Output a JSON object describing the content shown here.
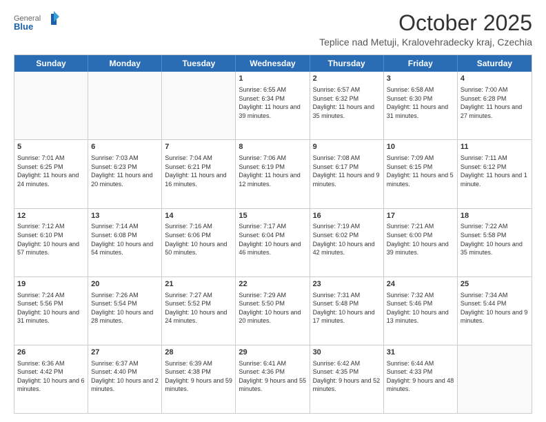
{
  "logo": {
    "general": "General",
    "blue": "Blue"
  },
  "title": "October 2025",
  "subtitle": "Teplice nad Metuji, Kralovehradecky kraj, Czechia",
  "header_days": [
    "Sunday",
    "Monday",
    "Tuesday",
    "Wednesday",
    "Thursday",
    "Friday",
    "Saturday"
  ],
  "weeks": [
    [
      {
        "day": "",
        "empty": true
      },
      {
        "day": "",
        "empty": true
      },
      {
        "day": "",
        "empty": true
      },
      {
        "day": "1",
        "sunrise": "6:55 AM",
        "sunset": "6:34 PM",
        "daylight": "11 hours and 39 minutes."
      },
      {
        "day": "2",
        "sunrise": "6:57 AM",
        "sunset": "6:32 PM",
        "daylight": "11 hours and 35 minutes."
      },
      {
        "day": "3",
        "sunrise": "6:58 AM",
        "sunset": "6:30 PM",
        "daylight": "11 hours and 31 minutes."
      },
      {
        "day": "4",
        "sunrise": "7:00 AM",
        "sunset": "6:28 PM",
        "daylight": "11 hours and 27 minutes."
      }
    ],
    [
      {
        "day": "5",
        "sunrise": "7:01 AM",
        "sunset": "6:25 PM",
        "daylight": "11 hours and 24 minutes."
      },
      {
        "day": "6",
        "sunrise": "7:03 AM",
        "sunset": "6:23 PM",
        "daylight": "11 hours and 20 minutes."
      },
      {
        "day": "7",
        "sunrise": "7:04 AM",
        "sunset": "6:21 PM",
        "daylight": "11 hours and 16 minutes."
      },
      {
        "day": "8",
        "sunrise": "7:06 AM",
        "sunset": "6:19 PM",
        "daylight": "11 hours and 12 minutes."
      },
      {
        "day": "9",
        "sunrise": "7:08 AM",
        "sunset": "6:17 PM",
        "daylight": "11 hours and 9 minutes."
      },
      {
        "day": "10",
        "sunrise": "7:09 AM",
        "sunset": "6:15 PM",
        "daylight": "11 hours and 5 minutes."
      },
      {
        "day": "11",
        "sunrise": "7:11 AM",
        "sunset": "6:12 PM",
        "daylight": "11 hours and 1 minute."
      }
    ],
    [
      {
        "day": "12",
        "sunrise": "7:12 AM",
        "sunset": "6:10 PM",
        "daylight": "10 hours and 57 minutes."
      },
      {
        "day": "13",
        "sunrise": "7:14 AM",
        "sunset": "6:08 PM",
        "daylight": "10 hours and 54 minutes."
      },
      {
        "day": "14",
        "sunrise": "7:16 AM",
        "sunset": "6:06 PM",
        "daylight": "10 hours and 50 minutes."
      },
      {
        "day": "15",
        "sunrise": "7:17 AM",
        "sunset": "6:04 PM",
        "daylight": "10 hours and 46 minutes."
      },
      {
        "day": "16",
        "sunrise": "7:19 AM",
        "sunset": "6:02 PM",
        "daylight": "10 hours and 42 minutes."
      },
      {
        "day": "17",
        "sunrise": "7:21 AM",
        "sunset": "6:00 PM",
        "daylight": "10 hours and 39 minutes."
      },
      {
        "day": "18",
        "sunrise": "7:22 AM",
        "sunset": "5:58 PM",
        "daylight": "10 hours and 35 minutes."
      }
    ],
    [
      {
        "day": "19",
        "sunrise": "7:24 AM",
        "sunset": "5:56 PM",
        "daylight": "10 hours and 31 minutes."
      },
      {
        "day": "20",
        "sunrise": "7:26 AM",
        "sunset": "5:54 PM",
        "daylight": "10 hours and 28 minutes."
      },
      {
        "day": "21",
        "sunrise": "7:27 AM",
        "sunset": "5:52 PM",
        "daylight": "10 hours and 24 minutes."
      },
      {
        "day": "22",
        "sunrise": "7:29 AM",
        "sunset": "5:50 PM",
        "daylight": "10 hours and 20 minutes."
      },
      {
        "day": "23",
        "sunrise": "7:31 AM",
        "sunset": "5:48 PM",
        "daylight": "10 hours and 17 minutes."
      },
      {
        "day": "24",
        "sunrise": "7:32 AM",
        "sunset": "5:46 PM",
        "daylight": "10 hours and 13 minutes."
      },
      {
        "day": "25",
        "sunrise": "7:34 AM",
        "sunset": "5:44 PM",
        "daylight": "10 hours and 9 minutes."
      }
    ],
    [
      {
        "day": "26",
        "sunrise": "6:36 AM",
        "sunset": "4:42 PM",
        "daylight": "10 hours and 6 minutes."
      },
      {
        "day": "27",
        "sunrise": "6:37 AM",
        "sunset": "4:40 PM",
        "daylight": "10 hours and 2 minutes."
      },
      {
        "day": "28",
        "sunrise": "6:39 AM",
        "sunset": "4:38 PM",
        "daylight": "9 hours and 59 minutes."
      },
      {
        "day": "29",
        "sunrise": "6:41 AM",
        "sunset": "4:36 PM",
        "daylight": "9 hours and 55 minutes."
      },
      {
        "day": "30",
        "sunrise": "6:42 AM",
        "sunset": "4:35 PM",
        "daylight": "9 hours and 52 minutes."
      },
      {
        "day": "31",
        "sunrise": "6:44 AM",
        "sunset": "4:33 PM",
        "daylight": "9 hours and 48 minutes."
      },
      {
        "day": "",
        "empty": true
      }
    ]
  ]
}
